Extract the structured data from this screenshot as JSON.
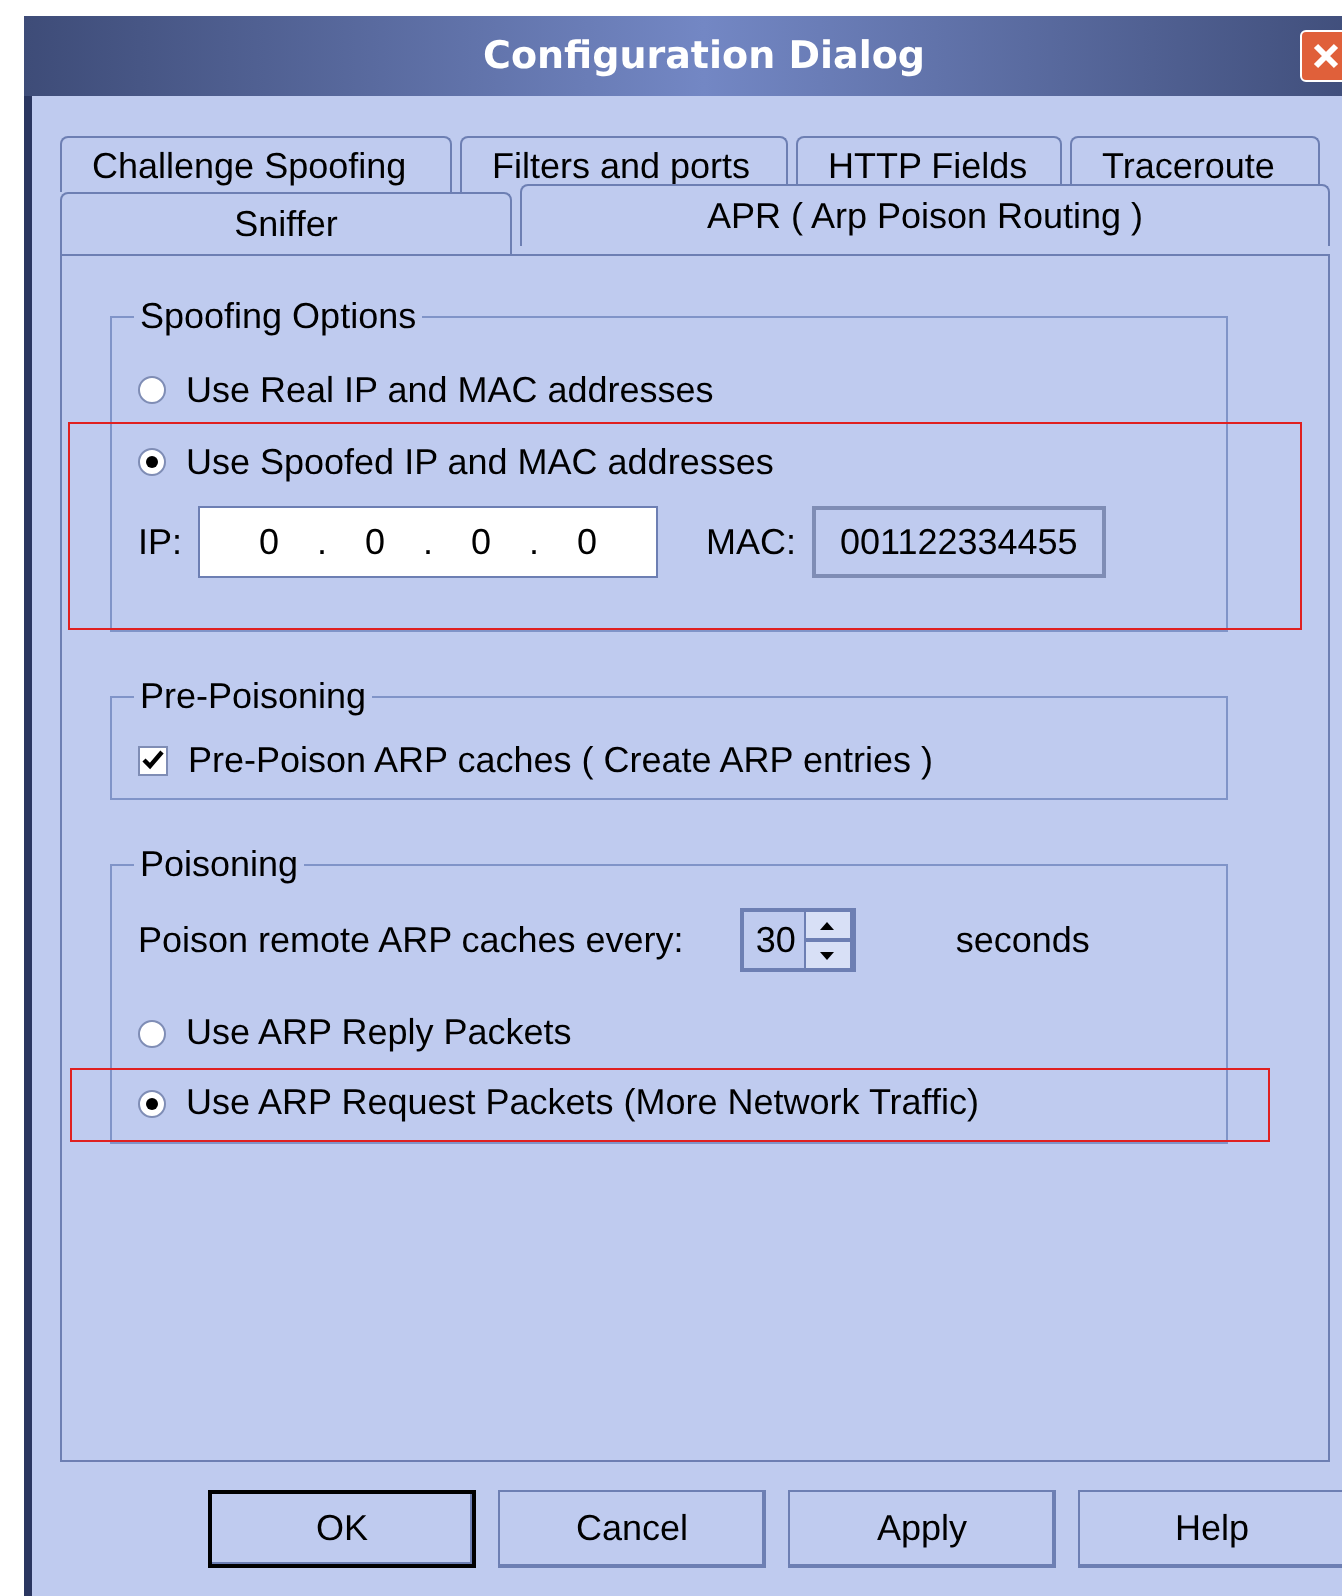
{
  "window": {
    "title": "Configuration Dialog"
  },
  "tab_rows": [
    {
      "tabs": [
        {
          "label": "Challenge Spoofing",
          "selected": false
        },
        {
          "label": "Filters and ports",
          "selected": false
        },
        {
          "label": "HTTP Fields",
          "selected": false
        },
        {
          "label": "Traceroute",
          "selected": false
        }
      ]
    },
    {
      "tabs": [
        {
          "label": "Sniffer",
          "selected": false
        },
        {
          "label": "APR ( Arp Poison Routing )",
          "selected": true
        }
      ]
    }
  ],
  "spoofing": {
    "title": "Spoofing Options",
    "highlighted": true,
    "options": [
      {
        "label": "Use Real IP and MAC addresses",
        "selected": false
      },
      {
        "label": "Use Spoofed IP and MAC addresses",
        "selected": true
      }
    ],
    "ip": {
      "label": "IP:",
      "octets": [
        "0",
        "0",
        "0",
        "0"
      ],
      "separator": "."
    },
    "mac": {
      "label": "MAC:",
      "value": "001122334455"
    }
  },
  "pre_poisoning": {
    "title": "Pre-Poisoning",
    "checkbox": {
      "label": "Pre-Poison ARP caches ( Create ARP entries )",
      "checked": true
    }
  },
  "poisoning": {
    "title": "Poisoning",
    "interval": {
      "label": "Poison remote ARP caches every:",
      "value": "30",
      "unit": "seconds"
    },
    "options": [
      {
        "label": "Use ARP Reply Packets",
        "selected": false,
        "highlighted": false
      },
      {
        "label": "Use ARP Request Packets (More Network Traffic)",
        "selected": true,
        "highlighted": true
      }
    ]
  },
  "buttons": [
    {
      "label": "OK",
      "default": true
    },
    {
      "label": "Cancel",
      "default": false
    },
    {
      "label": "Apply",
      "default": false
    },
    {
      "label": "Help",
      "default": false
    }
  ]
}
